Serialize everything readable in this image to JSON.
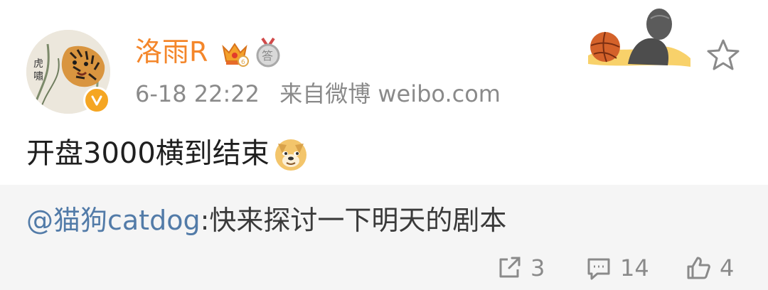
{
  "post": {
    "username": "洛雨R",
    "time": "6-18 22:22",
    "source": "来自微博 weibo.com",
    "content": "开盘3000横到结束",
    "badges": [
      "crown-badge-icon",
      "medal-badge-icon"
    ],
    "verified": true
  },
  "repost": {
    "mention": "@猫狗catdog",
    "separator": ":",
    "text": "快来探讨一下明天的剧本"
  },
  "actions": {
    "repost_count": "3",
    "comment_count": "14",
    "like_count": "4"
  },
  "colors": {
    "username": "#f4862a",
    "mention": "#527ba8",
    "meta": "#8a8a8a",
    "repost_bg": "#f5f5f5",
    "verified": "#f5a623"
  }
}
